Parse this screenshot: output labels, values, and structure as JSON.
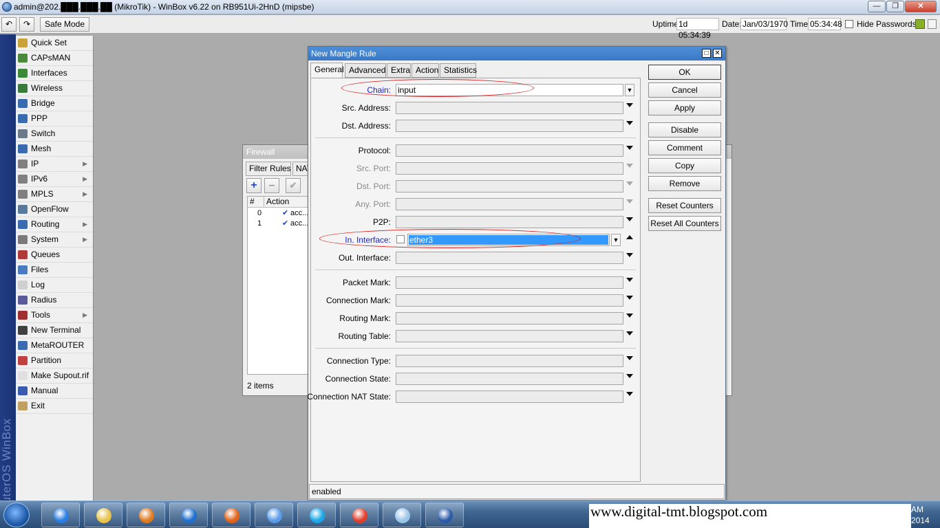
{
  "window": {
    "title": "admin@202.███.███.██ (MikroTik) - WinBox v6.22 on RB951Ui-2HnD (mipsbe)"
  },
  "toolbar": {
    "undo_icon": "undo-icon",
    "redo_icon": "redo-icon",
    "safe_mode": "Safe Mode",
    "uptime_label": "Uptime:",
    "uptime": "1d 05:34:39",
    "date_label": "Date:",
    "date": "Jan/03/1970",
    "time_label": "Time:",
    "time": "05:34:48",
    "hide_passwords": "Hide Passwords"
  },
  "brand": "RouterOS WinBox",
  "sidebar": {
    "items": [
      {
        "label": "Quick Set",
        "icon": "wand-icon",
        "color": "#c9a23a",
        "submenu": false
      },
      {
        "label": "CAPsMAN",
        "icon": "antenna-icon",
        "color": "#4a8a3a",
        "submenu": false
      },
      {
        "label": "Interfaces",
        "icon": "interfaces-icon",
        "color": "#3a8a3a",
        "submenu": false
      },
      {
        "label": "Wireless",
        "icon": "wireless-icon",
        "color": "#3a7a3a",
        "submenu": false
      },
      {
        "label": "Bridge",
        "icon": "bridge-icon",
        "color": "#3a6ab0",
        "submenu": false
      },
      {
        "label": "PPP",
        "icon": "ppp-icon",
        "color": "#3a6ab0",
        "submenu": false
      },
      {
        "label": "Switch",
        "icon": "switch-icon",
        "color": "#6a7a8a",
        "submenu": false
      },
      {
        "label": "Mesh",
        "icon": "mesh-icon",
        "color": "#3a6ab0",
        "submenu": false
      },
      {
        "label": "IP",
        "icon": "ip-icon",
        "color": "#808080",
        "submenu": true
      },
      {
        "label": "IPv6",
        "icon": "ipv6-icon",
        "color": "#808080",
        "submenu": true
      },
      {
        "label": "MPLS",
        "icon": "mpls-icon",
        "color": "#808080",
        "submenu": true
      },
      {
        "label": "OpenFlow",
        "icon": "openflow-icon",
        "color": "#5a7a9a",
        "submenu": false
      },
      {
        "label": "Routing",
        "icon": "routing-icon",
        "color": "#3a6ab0",
        "submenu": true
      },
      {
        "label": "System",
        "icon": "gear-icon",
        "color": "#7a7a7a",
        "submenu": true
      },
      {
        "label": "Queues",
        "icon": "queues-icon",
        "color": "#b03a3a",
        "submenu": false
      },
      {
        "label": "Files",
        "icon": "folder-icon",
        "color": "#4a7ac0",
        "submenu": false
      },
      {
        "label": "Log",
        "icon": "log-icon",
        "color": "#d0d0d0",
        "submenu": false
      },
      {
        "label": "Radius",
        "icon": "radius-icon",
        "color": "#5a5a9a",
        "submenu": false
      },
      {
        "label": "Tools",
        "icon": "tools-icon",
        "color": "#a03030",
        "submenu": true
      },
      {
        "label": "New Terminal",
        "icon": "terminal-icon",
        "color": "#404040",
        "submenu": false
      },
      {
        "label": "MetaROUTER",
        "icon": "metarouter-icon",
        "color": "#3a6ab0",
        "submenu": false
      },
      {
        "label": "Partition",
        "icon": "partition-icon",
        "color": "#c04040",
        "submenu": false
      },
      {
        "label": "Make Supout.rif",
        "icon": "document-icon",
        "color": "#e0e0e0",
        "submenu": false
      },
      {
        "label": "Manual",
        "icon": "help-icon",
        "color": "#3a5ab0",
        "submenu": false
      },
      {
        "label": "Exit",
        "icon": "exit-icon",
        "color": "#c0a060",
        "submenu": false
      }
    ]
  },
  "firewall": {
    "title": "Firewall",
    "tabs": [
      "Filter Rules",
      "NAT"
    ],
    "columns": [
      "#",
      "Action"
    ],
    "rows": [
      {
        "num": "0",
        "action": "acc..."
      },
      {
        "num": "1",
        "action": "acc..."
      }
    ],
    "count": "2 items"
  },
  "dialog": {
    "title": "New Mangle Rule",
    "tabs": [
      "General",
      "Advanced",
      "Extra",
      "Action",
      "Statistics"
    ],
    "fields": {
      "chain": {
        "label": "Chain:",
        "value": "input"
      },
      "src_address": {
        "label": "Src. Address:",
        "value": ""
      },
      "dst_address": {
        "label": "Dst. Address:",
        "value": ""
      },
      "protocol": {
        "label": "Protocol:",
        "value": ""
      },
      "src_port": {
        "label": "Src. Port:",
        "value": ""
      },
      "dst_port": {
        "label": "Dst. Port:",
        "value": ""
      },
      "any_port": {
        "label": "Any. Port:",
        "value": ""
      },
      "p2p": {
        "label": "P2P:",
        "value": ""
      },
      "in_interface": {
        "label": "In. Interface:",
        "value": "ether3"
      },
      "out_interface": {
        "label": "Out. Interface:",
        "value": ""
      },
      "packet_mark": {
        "label": "Packet Mark:",
        "value": ""
      },
      "connection_mark": {
        "label": "Connection Mark:",
        "value": ""
      },
      "routing_mark": {
        "label": "Routing Mark:",
        "value": ""
      },
      "routing_table": {
        "label": "Routing Table:",
        "value": ""
      },
      "connection_type": {
        "label": "Connection Type:",
        "value": ""
      },
      "connection_state": {
        "label": "Connection State:",
        "value": ""
      },
      "connection_nat_state": {
        "label": "Connection NAT State:",
        "value": ""
      }
    },
    "buttons": {
      "ok": "OK",
      "cancel": "Cancel",
      "apply": "Apply",
      "disable": "Disable",
      "comment": "Comment",
      "copy": "Copy",
      "remove": "Remove",
      "reset_counters": "Reset Counters",
      "reset_all_counters": "Reset All Counters"
    },
    "status": "enabled"
  },
  "taskbar": {
    "apps": [
      "internet-explorer-icon",
      "file-explorer-icon",
      "media-player-icon",
      "maxthon-icon",
      "firefox-icon",
      "globe-icon",
      "skype-icon",
      "chrome-icon",
      "notepad-icon",
      "winbox-icon"
    ],
    "clock_time": "AM",
    "clock_date": "2014"
  },
  "watermark": "www.digital-tmt.blogspot.com"
}
